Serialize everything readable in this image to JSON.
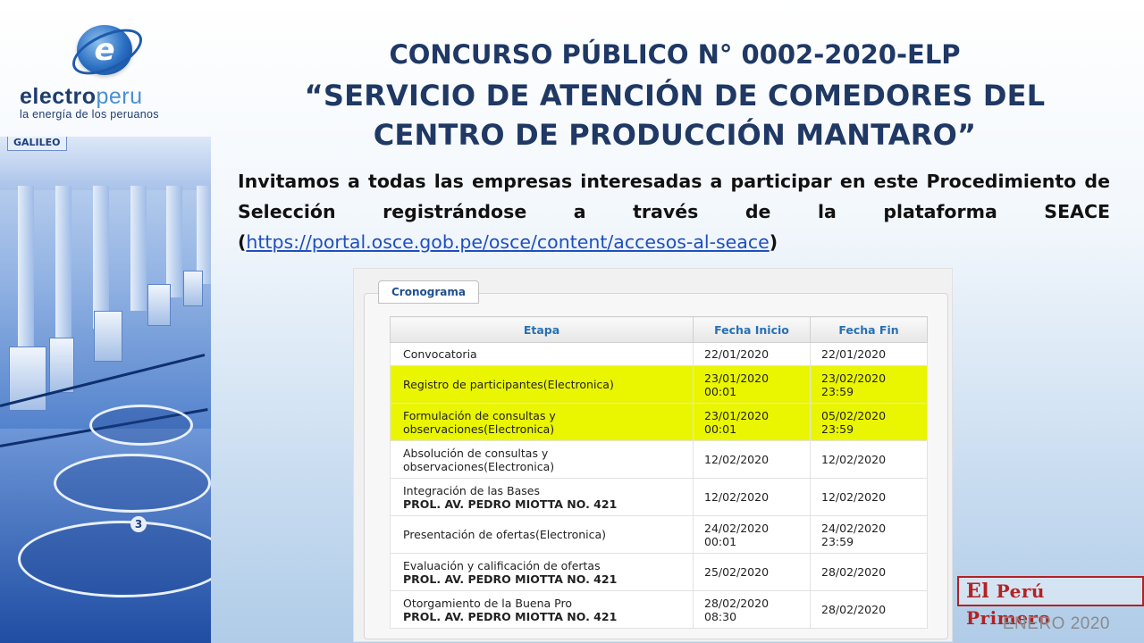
{
  "logo": {
    "mark": "e",
    "word_a": "electro",
    "word_b": "peru",
    "tagline": "la energía de los peruanos"
  },
  "photo": {
    "sign": "GALILEO",
    "unit_number": "3"
  },
  "title": {
    "line1": "CONCURSO PÚBLICO N° 0002-2020-ELP",
    "line2": "“SERVICIO DE ATENCIÓN DE COMEDORES DEL",
    "line3": "CENTRO DE PRODUCCIÓN MANTARO”"
  },
  "invite": {
    "text": "Invitamos a todas las empresas interesadas a participar en este Procedimiento de Selección registrándose a través de la plataforma SEACE",
    "open": "(",
    "link": "https://portal.osce.gob.pe/osce/content/accesos-al-seace",
    "close": ")"
  },
  "cronograma": {
    "tab_label": "Cronograma",
    "headers": {
      "etapa": "Etapa",
      "inicio": "Fecha Inicio",
      "fin": "Fecha Fin"
    },
    "rows": [
      {
        "etapa": "Convocatoria",
        "sub": "",
        "inicio": "22/01/2020",
        "inicio_time": "",
        "fin": "22/01/2020",
        "fin_time": "",
        "highlight": false
      },
      {
        "etapa": "Registro de participantes(Electronica)",
        "sub": "",
        "inicio": "23/01/2020",
        "inicio_time": "00:01",
        "fin": "23/02/2020",
        "fin_time": "23:59",
        "highlight": true
      },
      {
        "etapa": "Formulación de consultas y observaciones(Electronica)",
        "sub": "",
        "inicio": "23/01/2020",
        "inicio_time": "00:01",
        "fin": "05/02/2020",
        "fin_time": "23:59",
        "highlight": true
      },
      {
        "etapa": "Absolución de consultas y observaciones(Electronica)",
        "sub": "",
        "inicio": "12/02/2020",
        "inicio_time": "",
        "fin": "12/02/2020",
        "fin_time": "",
        "highlight": false
      },
      {
        "etapa": "Integración de las Bases",
        "sub": "PROL. AV. PEDRO MIOTTA NO. 421",
        "inicio": "12/02/2020",
        "inicio_time": "",
        "fin": "12/02/2020",
        "fin_time": "",
        "highlight": false
      },
      {
        "etapa": "Presentación de ofertas(Electronica)",
        "sub": "",
        "inicio": "24/02/2020",
        "inicio_time": "00:01",
        "fin": "24/02/2020",
        "fin_time": "23:59",
        "highlight": false
      },
      {
        "etapa": "Evaluación y calificación de ofertas",
        "sub": "PROL. AV. PEDRO MIOTTA NO. 421",
        "inicio": "25/02/2020",
        "inicio_time": "",
        "fin": "28/02/2020",
        "fin_time": "",
        "highlight": false
      },
      {
        "etapa": "Otorgamiento de la Buena Pro",
        "sub": "PROL. AV. PEDRO MIOTTA NO. 421",
        "inicio": "28/02/2020",
        "inicio_time": "08:30",
        "fin": "28/02/2020",
        "fin_time": "",
        "highlight": false
      }
    ]
  },
  "brand": {
    "text_el": "El",
    "text_rest": "Perú Primero"
  },
  "date": "ENERO 2020",
  "colors": {
    "title": "#1f3864",
    "highlight": "#eaf600",
    "brand": "#b22222",
    "link": "#1f4fbf"
  }
}
